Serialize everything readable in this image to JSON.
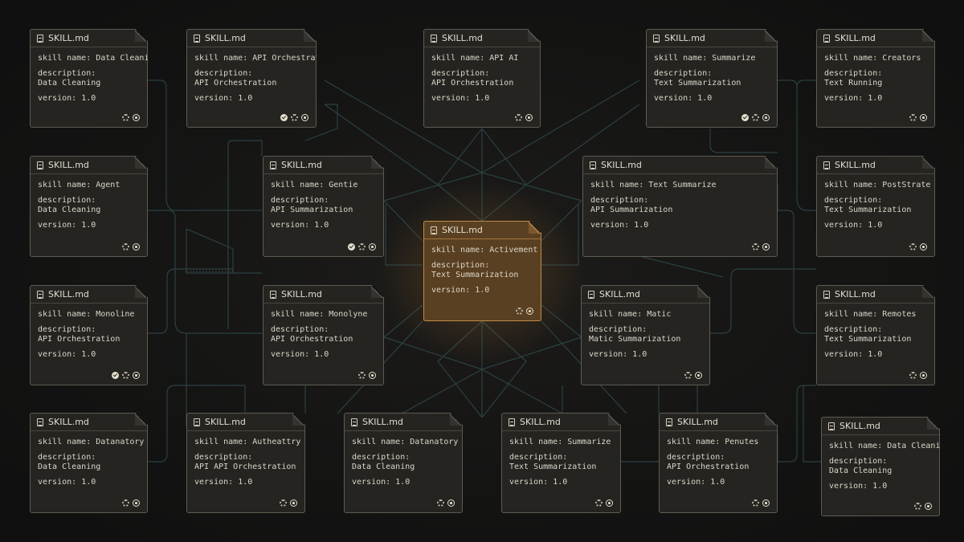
{
  "labels": {
    "name_prefix": "skill name: ",
    "description": "description:",
    "version_prefix": "version: "
  },
  "colors": {
    "background": "#141413",
    "card": "#252421",
    "card_border": "#5f5b52",
    "highlight": "#5a4022",
    "highlight_border": "#c08a45",
    "wire": "#2f4a4a"
  },
  "cards": [
    {
      "file": "SKILL.md",
      "name": "Data Cleaning",
      "description": "Data Cleaning",
      "version": "1.0",
      "icons": [
        "gear-icon",
        "ring-icon"
      ]
    },
    {
      "file": "SKILL.md",
      "name": "API Orchestration",
      "description": "API Orchestration",
      "version": "1.0",
      "icons": [
        "check-icon",
        "gear-icon",
        "ring-icon"
      ]
    },
    {
      "file": "SKILL.md",
      "name": "API AI",
      "description": "API Orchestration",
      "version": "1.0",
      "icons": [
        "gear-icon",
        "ring-icon"
      ]
    },
    {
      "file": "SKILL.md",
      "name": "Summarize",
      "description": "Text Summarization",
      "version": "1.0",
      "icons": [
        "check-icon",
        "gear-icon",
        "ring-icon"
      ]
    },
    {
      "file": "SKILL.md",
      "name": "Creators",
      "description": "Text Running",
      "version": "1.0",
      "icons": [
        "gear-icon",
        "ring-icon"
      ]
    },
    {
      "file": "SKILL.md",
      "name": "Agent",
      "description": "Data Cleaning",
      "version": "1.0",
      "icons": [
        "gear-icon",
        "ring-icon"
      ]
    },
    {
      "file": "SKILL.md",
      "name": "Gentie",
      "description": "API Summarization",
      "version": "1.0",
      "icons": [
        "check-icon",
        "gear-icon",
        "ring-icon"
      ]
    },
    {
      "file": "SKILL.md",
      "name": "Text Summarize",
      "description": "API Summarization",
      "version": "1.0",
      "icons": [
        "gear-icon",
        "ring-icon"
      ]
    },
    {
      "file": "SKILL.md",
      "name": "PostStrate",
      "description": "Text Summarization",
      "version": "1.0",
      "icons": [
        "gear-icon",
        "ring-icon"
      ]
    },
    {
      "file": "SKILL.md",
      "name": "Activement",
      "description": "Text Summarization",
      "version": "1.0",
      "icons": [
        "gear-icon",
        "ring-icon"
      ],
      "highlighted": true
    },
    {
      "file": "SKILL.md",
      "name": "Monoline",
      "description": "API Orchestration",
      "version": "1.0",
      "icons": [
        "check-icon",
        "gear-icon",
        "ring-icon"
      ]
    },
    {
      "file": "SKILL.md",
      "name": "Monolyne",
      "description": "API Orchestration",
      "version": "1.0",
      "icons": [
        "gear-icon",
        "ring-icon"
      ]
    },
    {
      "file": "SKILL.md",
      "name": "Matic",
      "description": "Matic Summarization",
      "version": "1.0",
      "icons": [
        "gear-icon",
        "ring-icon"
      ]
    },
    {
      "file": "SKILL.md",
      "name": "Remotes",
      "description": "Text Summarization",
      "version": "1.0",
      "icons": [
        "gear-icon",
        "ring-icon"
      ]
    },
    {
      "file": "SKILL.md",
      "name": "Datanatory",
      "description": "Data Cleaning",
      "version": "1.0",
      "icons": [
        "gear-icon",
        "ring-icon"
      ]
    },
    {
      "file": "SKILL.md",
      "name": "Autheattry",
      "description": "API API Orchestration",
      "version": "1.0",
      "icons": [
        "gear-icon",
        "ring-icon"
      ]
    },
    {
      "file": "SKILL.md",
      "name": "Datanatory",
      "description": "Data Cleaning",
      "version": "1.0",
      "icons": [
        "gear-icon",
        "ring-icon"
      ]
    },
    {
      "file": "SKILL.md",
      "name": "Summarize",
      "description": "Text Summarization",
      "version": "1.0",
      "icons": [
        "gear-icon",
        "ring-icon"
      ]
    },
    {
      "file": "SKILL.md",
      "name": "Penutes",
      "description": "API Orchestration",
      "version": "1.0",
      "icons": [
        "gear-icon",
        "ring-icon"
      ]
    },
    {
      "file": "SKILL.md",
      "name": "Data Cleaning",
      "description": "Data Cleaning",
      "version": "1.0",
      "icons": [
        "gear-icon",
        "ring-icon"
      ]
    }
  ]
}
